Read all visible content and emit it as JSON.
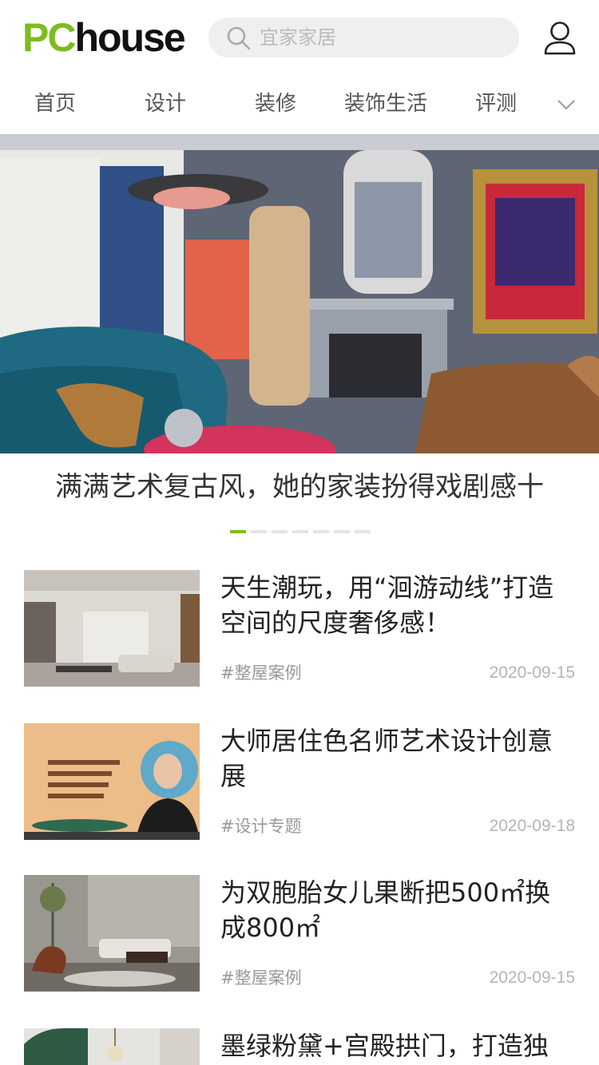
{
  "header": {
    "logo_pc": "PC",
    "logo_house": "house",
    "search_placeholder": "宜家家居"
  },
  "nav": {
    "items": [
      {
        "label": "首页"
      },
      {
        "label": "设计"
      },
      {
        "label": "装修"
      },
      {
        "label": "装饰生活"
      },
      {
        "label": "评测"
      }
    ]
  },
  "banner": {
    "title": "满满艺术复古风，她的家装扮得戏剧感十",
    "slide_count": 7,
    "active_slide": 1
  },
  "articles": [
    {
      "title_line1": "天生潮玩，用“洄游动线”打造",
      "title_line2": "空间的尺度奢侈感！",
      "tag": "#整屋案例",
      "date": "2020-09-15"
    },
    {
      "title_line1": "大师居住色名师艺术设计创意",
      "title_line2": "展",
      "tag": "#设计专题",
      "date": "2020-09-18"
    },
    {
      "title_line1": "为双胞胎女儿果断把500㎡换",
      "title_line2": "成800㎡",
      "tag": "#整屋案例",
      "date": "2020-09-15"
    },
    {
      "title_line1": "墨绿粉黛+宫殿拱门，打造独",
      "title_line2": "",
      "tag": "",
      "date": ""
    }
  ],
  "colors": {
    "accent": "#7dbb1f",
    "text_primary": "#222222",
    "text_muted": "#999999"
  }
}
